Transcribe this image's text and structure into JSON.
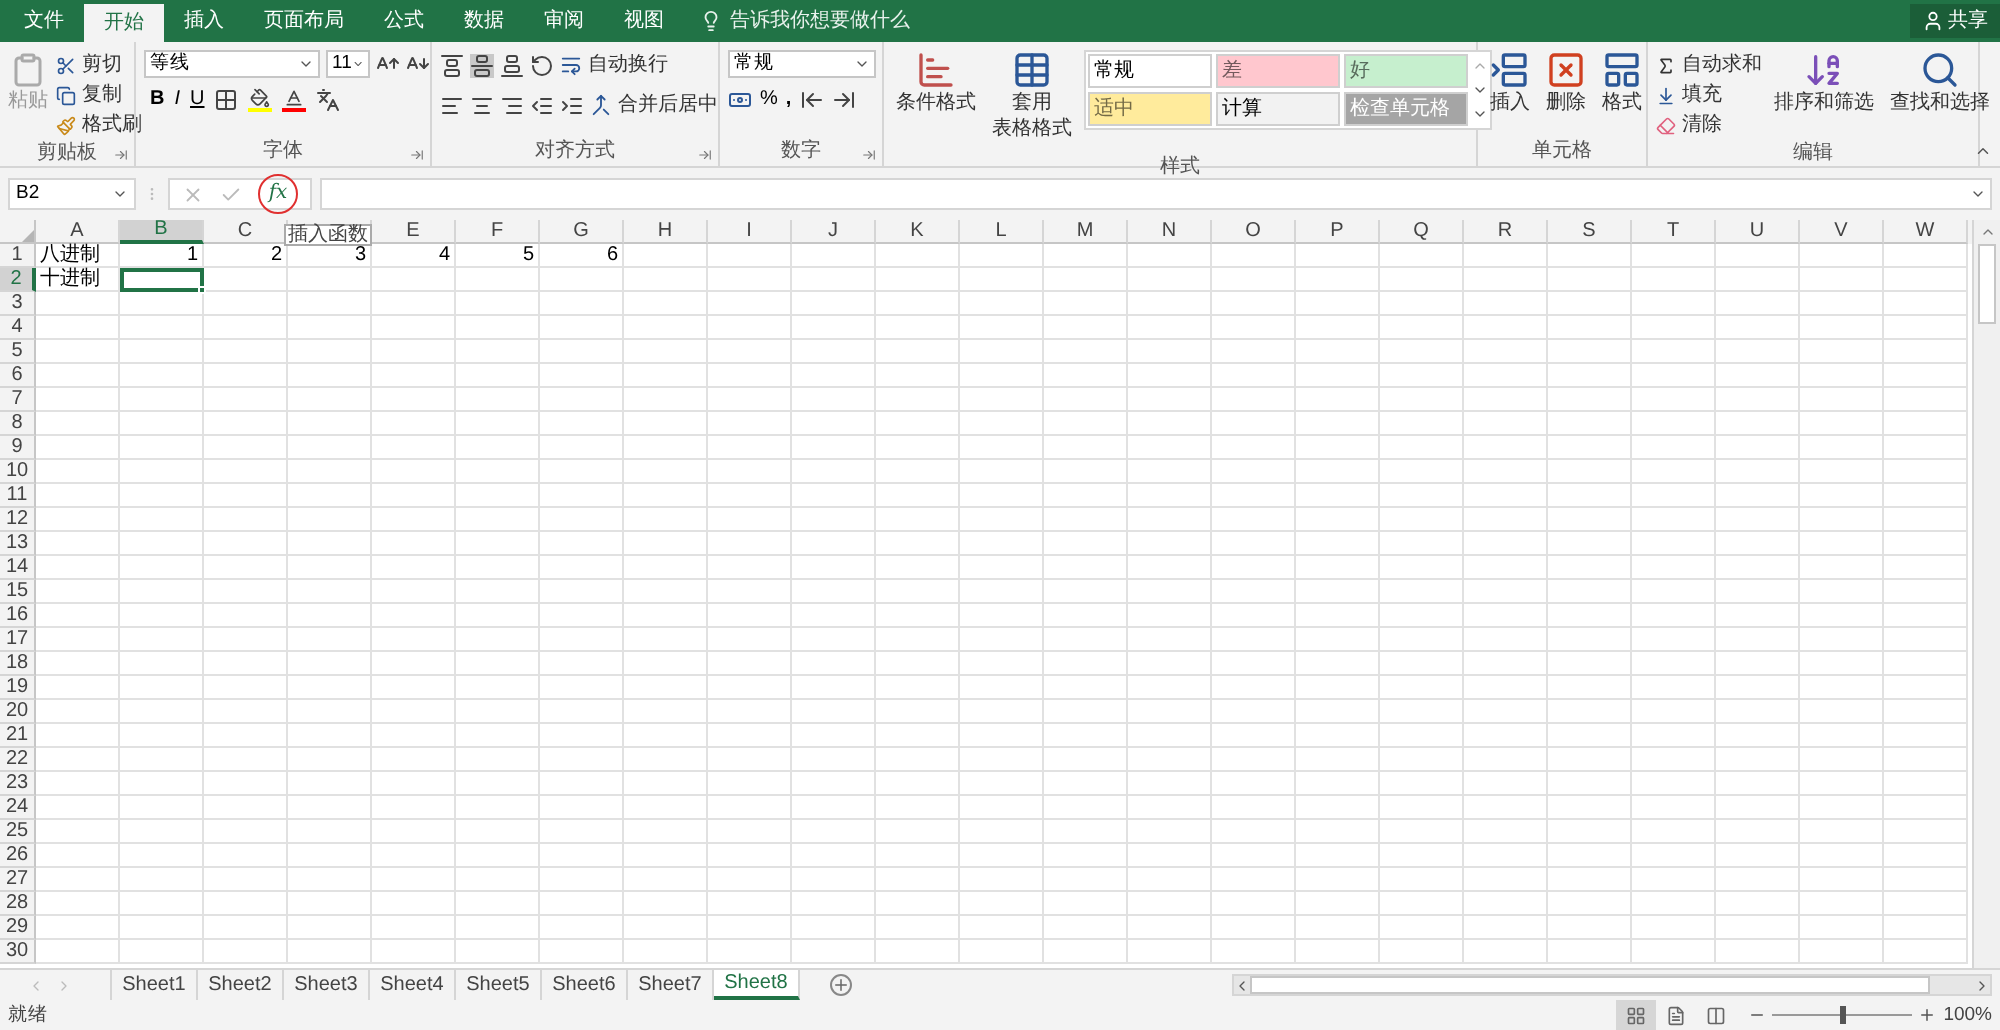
{
  "tabs": [
    {
      "label": "文件",
      "selected": false
    },
    {
      "label": "开始",
      "selected": true
    },
    {
      "label": "插入",
      "selected": false
    },
    {
      "label": "页面布局",
      "selected": false
    },
    {
      "label": "公式",
      "selected": false
    },
    {
      "label": "数据",
      "selected": false
    },
    {
      "label": "审阅",
      "selected": false
    },
    {
      "label": "视图",
      "selected": false
    }
  ],
  "tell_me": "告诉我你想要做什么",
  "share": "共享",
  "clipboard": {
    "paste": "粘贴",
    "items": [
      "剪切",
      "复制",
      "格式刷"
    ],
    "label": "剪贴板"
  },
  "font": {
    "name": "等线",
    "size": "11",
    "bold": "B",
    "italic": "I",
    "underline": "U",
    "label": "字体"
  },
  "alignment": {
    "wrap": "自动换行",
    "merge": "合并后居中",
    "label": "对齐方式"
  },
  "number": {
    "format": "常规",
    "percent": "%",
    "comma": ",",
    "label": "数字"
  },
  "styles": {
    "conditional": "条件格式",
    "table": [
      "套用",
      "表格格式"
    ],
    "label": "样式",
    "cell_styles": [
      {
        "label": "常规",
        "color": "#ffffff"
      },
      {
        "label": "差",
        "color": "#ffc7ce"
      },
      {
        "label": "好",
        "color": "#c6efce"
      },
      {
        "label": "适中",
        "color": "#ffeb9c"
      },
      {
        "label": "计算",
        "color": "#f2f2f2"
      },
      {
        "label": "检查单元格",
        "color": "#a5a5a5"
      }
    ]
  },
  "cells": {
    "buttons": [
      "插入",
      "删除",
      "格式"
    ],
    "label": "单元格"
  },
  "editing": {
    "autosum": "自动求和",
    "fill": "填充",
    "clear": "清除",
    "sort": "排序和筛选",
    "find": "查找和选择",
    "label": "编辑"
  },
  "formula_bar": {
    "name_box": "B2",
    "fx": "fx",
    "tooltip": "插入函数"
  },
  "columns": [
    {
      "label": "A",
      "selected": false
    },
    {
      "label": "B",
      "selected": true
    },
    {
      "label": "C",
      "selected": false
    },
    {
      "selected": false
    },
    {
      "label": "E",
      "selected": false
    },
    {
      "label": "F",
      "selected": false
    },
    {
      "label": "G",
      "selected": false
    },
    {
      "label": "H",
      "selected": false
    },
    {
      "label": "I",
      "selected": false
    },
    {
      "label": "J",
      "selected": false
    },
    {
      "label": "K",
      "selected": false
    },
    {
      "label": "L",
      "selected": false
    },
    {
      "label": "M",
      "selected": false
    },
    {
      "label": "N",
      "selected": false
    },
    {
      "label": "O",
      "selected": false
    },
    {
      "label": "P",
      "selected": false
    },
    {
      "label": "Q",
      "selected": false
    },
    {
      "label": "R",
      "selected": false
    },
    {
      "label": "S",
      "selected": false
    },
    {
      "label": "T",
      "selected": false
    },
    {
      "label": "U",
      "selected": false
    },
    {
      "label": "V",
      "selected": false
    },
    {
      "label": "W",
      "selected": false
    }
  ],
  "rows": [
    {
      "label": "1",
      "selected": false,
      "cells": [
        {
          "kind": "text",
          "value": "八进制",
          "selected": false
        },
        {
          "kind": "number",
          "value": "1",
          "selected": false
        },
        {
          "kind": "number",
          "value": "2",
          "selected": false
        },
        {
          "kind": "number",
          "value": "3",
          "selected": false
        },
        {
          "kind": "number",
          "value": "4",
          "selected": false
        },
        {
          "kind": "number",
          "value": "5",
          "selected": false
        },
        {
          "kind": "number",
          "value": "6",
          "selected": false
        }
      ]
    },
    {
      "label": "2",
      "selected": true,
      "cells": [
        {
          "kind": "text",
          "value": "十进制",
          "selected": false
        },
        {
          "kind": "empty",
          "selected": true
        }
      ]
    },
    {
      "label": "3",
      "selected": false
    },
    {
      "label": "4",
      "selected": false
    },
    {
      "label": "5",
      "selected": false
    },
    {
      "label": "6",
      "selected": false
    },
    {
      "label": "7",
      "selected": false
    },
    {
      "label": "8",
      "selected": false
    },
    {
      "label": "9",
      "selected": false
    },
    {
      "label": "10",
      "selected": false
    },
    {
      "label": "11",
      "selected": false
    },
    {
      "label": "12",
      "selected": false
    },
    {
      "label": "13",
      "selected": false
    },
    {
      "label": "14",
      "selected": false
    },
    {
      "label": "15",
      "selected": false
    },
    {
      "label": "16",
      "selected": false
    },
    {
      "label": "17",
      "selected": false
    },
    {
      "label": "18",
      "selected": false
    },
    {
      "label": "19",
      "selected": false
    },
    {
      "label": "20",
      "selected": false
    },
    {
      "label": "21",
      "selected": false
    },
    {
      "label": "22",
      "selected": false
    },
    {
      "label": "23",
      "selected": false
    },
    {
      "label": "24",
      "selected": false
    },
    {
      "label": "25",
      "selected": false
    },
    {
      "label": "26",
      "selected": false
    },
    {
      "label": "27",
      "selected": false
    },
    {
      "label": "28",
      "selected": false
    },
    {
      "label": "29",
      "selected": false
    },
    {
      "label": "30",
      "selected": false
    }
  ],
  "sheets": [
    {
      "label": "Sheet1",
      "selected": false
    },
    {
      "label": "Sheet2",
      "selected": false
    },
    {
      "label": "Sheet3",
      "selected": false
    },
    {
      "label": "Sheet4",
      "selected": false
    },
    {
      "label": "Sheet5",
      "selected": false
    },
    {
      "label": "Sheet6",
      "selected": false
    },
    {
      "label": "Sheet7",
      "selected": false
    },
    {
      "label": "Sheet8",
      "selected": true
    }
  ],
  "status": {
    "text": "就绪",
    "views": [
      {
        "kind": "normal",
        "selected": true
      },
      {
        "kind": "page-layout",
        "selected": false
      },
      {
        "kind": "page-break",
        "selected": false
      }
    ],
    "zoom": {
      "level": 0.5,
      "text": "100%"
    }
  }
}
